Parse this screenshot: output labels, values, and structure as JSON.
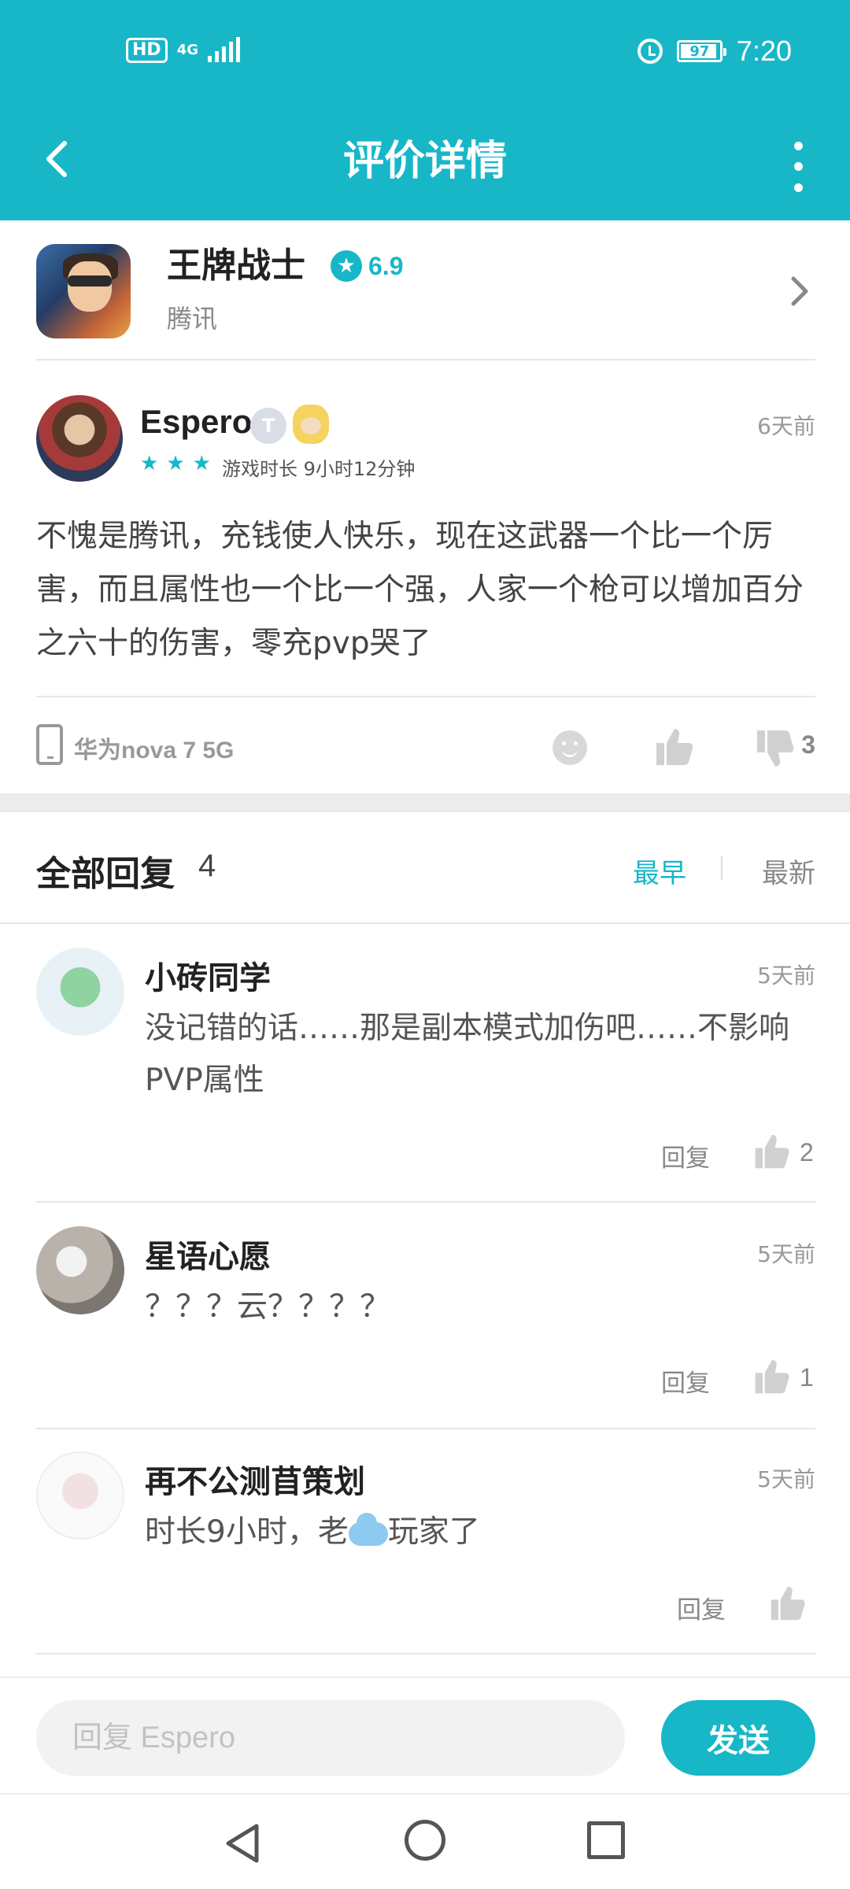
{
  "status_bar": {
    "hd": "HD",
    "network": "4G",
    "battery": "97",
    "time": "7:20"
  },
  "header": {
    "title": "评价详情"
  },
  "game": {
    "name": "王牌战士",
    "score": "6.9",
    "publisher": "腾讯"
  },
  "review": {
    "author": "Espero",
    "badge": "T",
    "time": "6天前",
    "stars": 3,
    "star_glyph": "★",
    "playtime": "游戏时长 9小时12分钟",
    "text": "不愧是腾讯，充钱使人快乐，现在这武器一个比一个厉害，而且属性也一个比一个强，人家一个枪可以增加百分之六十的伤害，零充pvp哭了",
    "device": "华为nova 7 5G",
    "dislike_count": "3"
  },
  "replies": {
    "title": "全部回复",
    "count": "4",
    "sort_earliest": "最早",
    "sort_newest": "最新",
    "reply_label": "回复",
    "items": [
      {
        "name": "小砖同学",
        "time": "5天前",
        "text": "没记错的话……那是副本模式加伤吧……不影响PVP属性",
        "likes": "2"
      },
      {
        "name": "星语心愿",
        "time": "5天前",
        "text": "？？？云？？？？",
        "likes": "1"
      },
      {
        "name": "再不公测苜策划",
        "time": "5天前",
        "text_before": "时长9小时，老",
        "text_after": "玩家了",
        "likes": ""
      }
    ]
  },
  "input": {
    "placeholder": "回复 Espero",
    "value": "",
    "send_label": "发送"
  },
  "colors": {
    "accent": "#17b7c8",
    "muted": "#888888"
  }
}
